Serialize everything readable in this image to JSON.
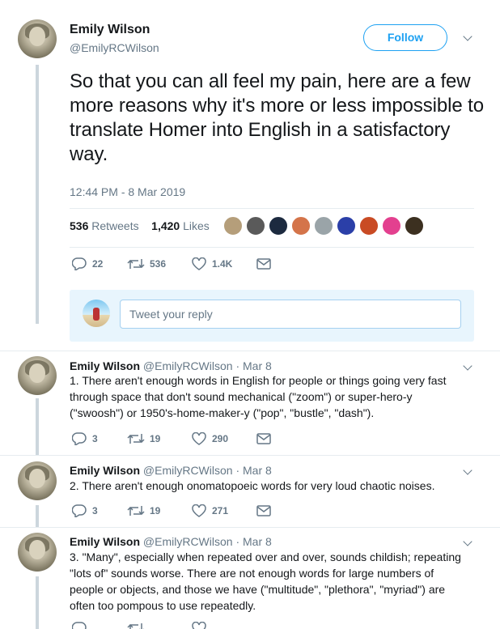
{
  "main": {
    "name": "Emily Wilson",
    "handle": "@EmilyRCWilson",
    "follow_label": "Follow",
    "text": "So that you can all feel my pain, here are a few more reasons why it's more or less impossible to translate Homer into English in a satisfactory way.",
    "timestamp": "12:44 PM - 8 Mar 2019",
    "retweets_count": "536",
    "retweets_label": "Retweets",
    "likes_count": "1,420",
    "likes_label": "Likes",
    "likers": [
      "#b59e7a",
      "#5a5a5a",
      "#1c2a3f",
      "#d4744a",
      "#9aa4a8",
      "#2b3fa8",
      "#c94b24",
      "#e3408f",
      "#3c3020"
    ],
    "actions": {
      "replies": "22",
      "retweets": "536",
      "likes": "1.4K"
    }
  },
  "reply_box": {
    "placeholder": "Tweet your reply"
  },
  "replies": [
    {
      "name": "Emily Wilson",
      "handle_date": "@EmilyRCWilson · Mar 8",
      "text": "1.  There aren't enough words in English for people or things going very fast through space that don't sound mechanical (\"zoom\") or super-hero-y (\"swoosh\") or 1950's-home-maker-y (\"pop\", \"bustle\", \"dash\").",
      "replies": "3",
      "retweets": "19",
      "likes": "290"
    },
    {
      "name": "Emily Wilson",
      "handle_date": "@EmilyRCWilson · Mar 8",
      "text": "2.  There aren't enough onomatopoeic words for very loud chaotic noises.",
      "replies": "3",
      "retweets": "19",
      "likes": "271"
    },
    {
      "name": "Emily Wilson",
      "handle_date": "@EmilyRCWilson · Mar 8",
      "text": "3. \"Many\", especially when repeated over and over, sounds childish; repeating \"lots of\" sounds worse.  There are not enough words for large numbers of people or objects, and those we have (\"multitude\", \"plethora\", \"myriad\") are often too pompous to use repeatedly.",
      "replies": "",
      "retweets": "",
      "likes": ""
    }
  ],
  "colors": {
    "accent": "#1da1f2",
    "secondary_text": "#657786",
    "thread_line": "#ccd6dd"
  }
}
